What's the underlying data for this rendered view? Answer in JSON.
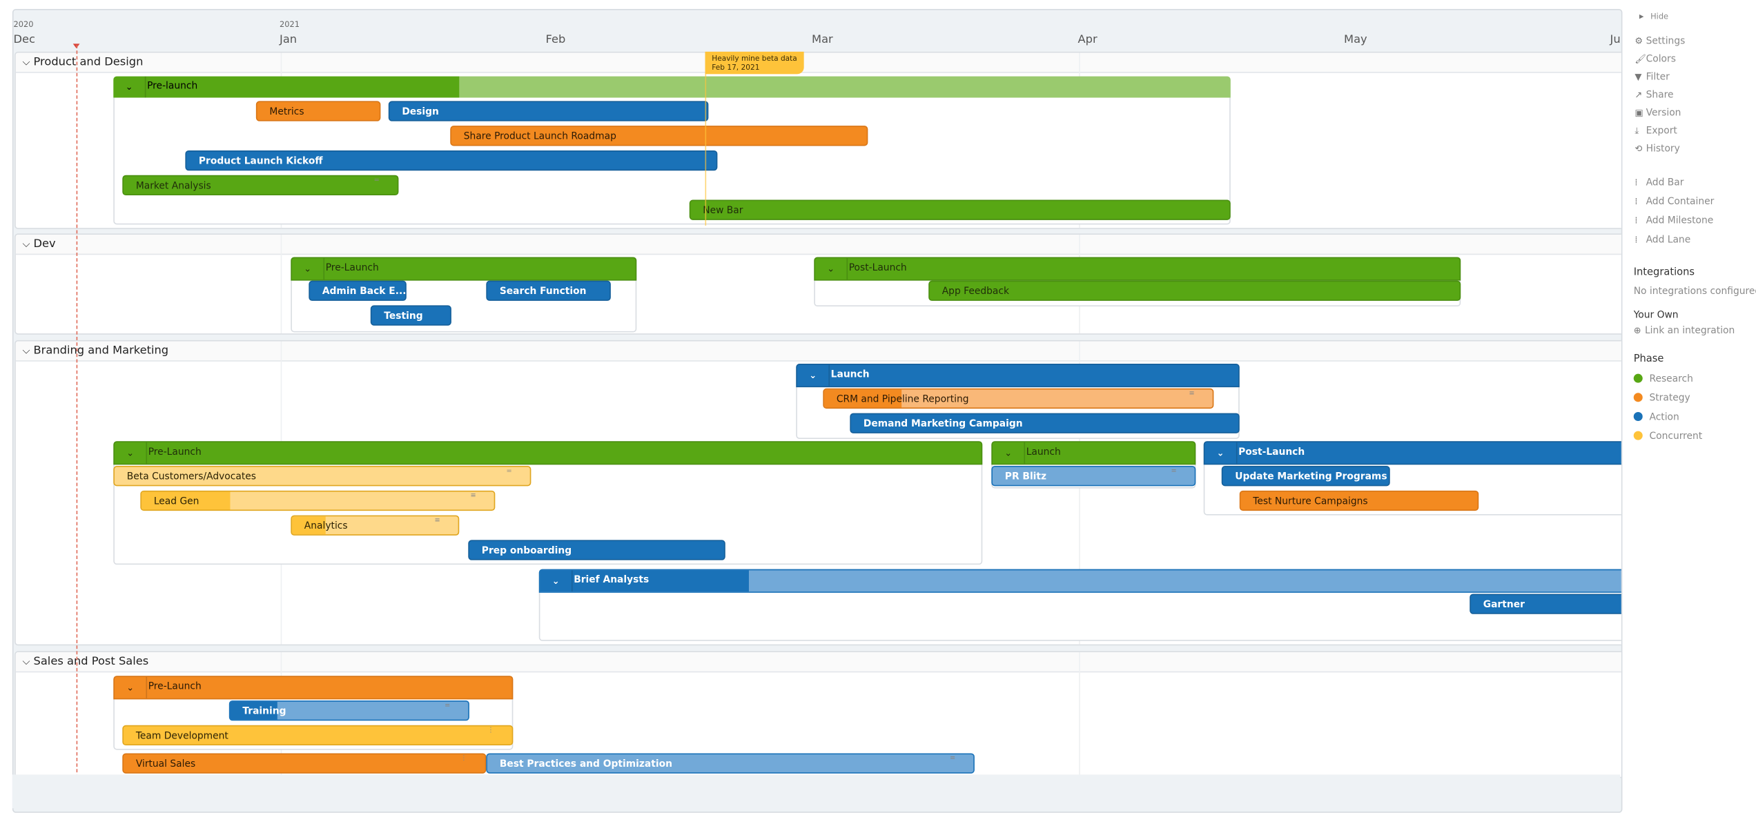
{
  "timeline": {
    "years": [
      {
        "label": "2020",
        "month_index": 0
      },
      {
        "label": "2021",
        "month_index": 1
      }
    ],
    "months": [
      "Dec",
      "Jan",
      "Feb",
      "Mar",
      "Apr",
      "May",
      "Jun"
    ],
    "today_month_offset": 0.24
  },
  "milestone": {
    "title": "Heavily mine beta data",
    "date": "Feb 17, 2021",
    "month_pos": 2.57
  },
  "lanes": [
    {
      "name": "Product and Design"
    },
    {
      "name": "Dev"
    },
    {
      "name": "Branding and Marketing"
    },
    {
      "name": "Sales and Post Sales"
    }
  ],
  "containers": [
    {
      "id": "pd-prelaunch",
      "label": "Pre-launch",
      "color": "green",
      "progress": 0.31
    },
    {
      "id": "dev-prelaunch",
      "label": "Pre-Launch",
      "color": "green",
      "progress": 1
    },
    {
      "id": "dev-postlaunch",
      "label": "Post-Launch",
      "color": "green",
      "progress": 1
    },
    {
      "id": "bm-launch-top",
      "label": "Launch",
      "color": "blue",
      "progress": 1
    },
    {
      "id": "bm-prelaunch",
      "label": "Pre-Launch",
      "color": "green",
      "progress": 1
    },
    {
      "id": "bm-launch",
      "label": "Launch",
      "color": "green",
      "progress": 1
    },
    {
      "id": "bm-postlaunch",
      "label": "Post-Launch",
      "color": "blue",
      "progress": 1
    },
    {
      "id": "bm-brief",
      "label": "Brief Analysts",
      "color": "blue",
      "progress": 0.19
    },
    {
      "id": "sp-prelaunch",
      "label": "Pre-Launch",
      "color": "orange",
      "progress": 1
    }
  ],
  "bars": [
    {
      "label": "Metrics",
      "color": "orange",
      "progress": 1
    },
    {
      "label": "Design",
      "color": "blue",
      "progress": 1
    },
    {
      "label": "Share Product Launch Roadmap",
      "color": "orange",
      "progress": 1
    },
    {
      "label": "Product Launch Kickoff",
      "color": "blue",
      "progress": 1
    },
    {
      "label": "Market Analysis",
      "color": "green",
      "progress": 1
    },
    {
      "label": "New Bar",
      "color": "green",
      "progress": 1
    },
    {
      "label": "Admin Back E...",
      "color": "blue",
      "progress": 1
    },
    {
      "label": "Search Function",
      "color": "blue",
      "progress": 1
    },
    {
      "label": "Testing",
      "color": "blue",
      "progress": 1
    },
    {
      "label": "App Feedback",
      "color": "green",
      "progress": 1
    },
    {
      "label": "CRM and Pipeline Reporting",
      "color": "orange",
      "progress": 0.2
    },
    {
      "label": "Demand Marketing Campaign",
      "color": "blue",
      "progress": 1
    },
    {
      "label": "Beta Customers/Advocates",
      "color": "yellow",
      "progress": 0
    },
    {
      "label": "Lead Gen",
      "color": "yellow",
      "progress": 0.25
    },
    {
      "label": "Analytics",
      "color": "yellow",
      "progress": 0.2
    },
    {
      "label": "Prep onboarding",
      "color": "blue",
      "progress": 1
    },
    {
      "label": "PR Blitz",
      "color": "blue",
      "progress": 0
    },
    {
      "label": "Update Marketing Programs",
      "color": "blue",
      "progress": 1
    },
    {
      "label": "Test Nurture Campaigns",
      "color": "orange",
      "progress": 1
    },
    {
      "label": "Gartner",
      "color": "blue",
      "progress": 1
    },
    {
      "label": "Training",
      "color": "blue",
      "progress": 0.2
    },
    {
      "label": "Team Development",
      "color": "yellow",
      "progress": 1
    },
    {
      "label": "Virtual Sales",
      "color": "orange",
      "progress": 1
    },
    {
      "label": "Best Practices and Optimization",
      "color": "blue",
      "progress": 0
    }
  ],
  "panel": {
    "hide": "Hide",
    "menu": [
      {
        "label": "Settings",
        "icon": "gear-icon"
      },
      {
        "label": "Colors",
        "icon": "brush-icon"
      },
      {
        "label": "Filter",
        "icon": "filter-icon"
      },
      {
        "label": "Share",
        "icon": "share-icon"
      },
      {
        "label": "Version",
        "icon": "archive-icon"
      },
      {
        "label": "Export",
        "icon": "download-icon"
      },
      {
        "label": "History",
        "icon": "history-icon"
      }
    ],
    "add": [
      "Add Bar",
      "Add Container",
      "Add Milestone",
      "Add Lane"
    ],
    "integrations_title": "Integrations",
    "integrations_empty": "No integrations configured",
    "your_own": "Your Own",
    "link_integration": "Link an integration",
    "phase_title": "Phase",
    "phases": [
      {
        "label": "Research",
        "color": "#58a714"
      },
      {
        "label": "Strategy",
        "color": "#f38a20"
      },
      {
        "label": "Action",
        "color": "#1a72b8"
      },
      {
        "label": "Concurrent",
        "color": "#fec33a"
      }
    ]
  }
}
